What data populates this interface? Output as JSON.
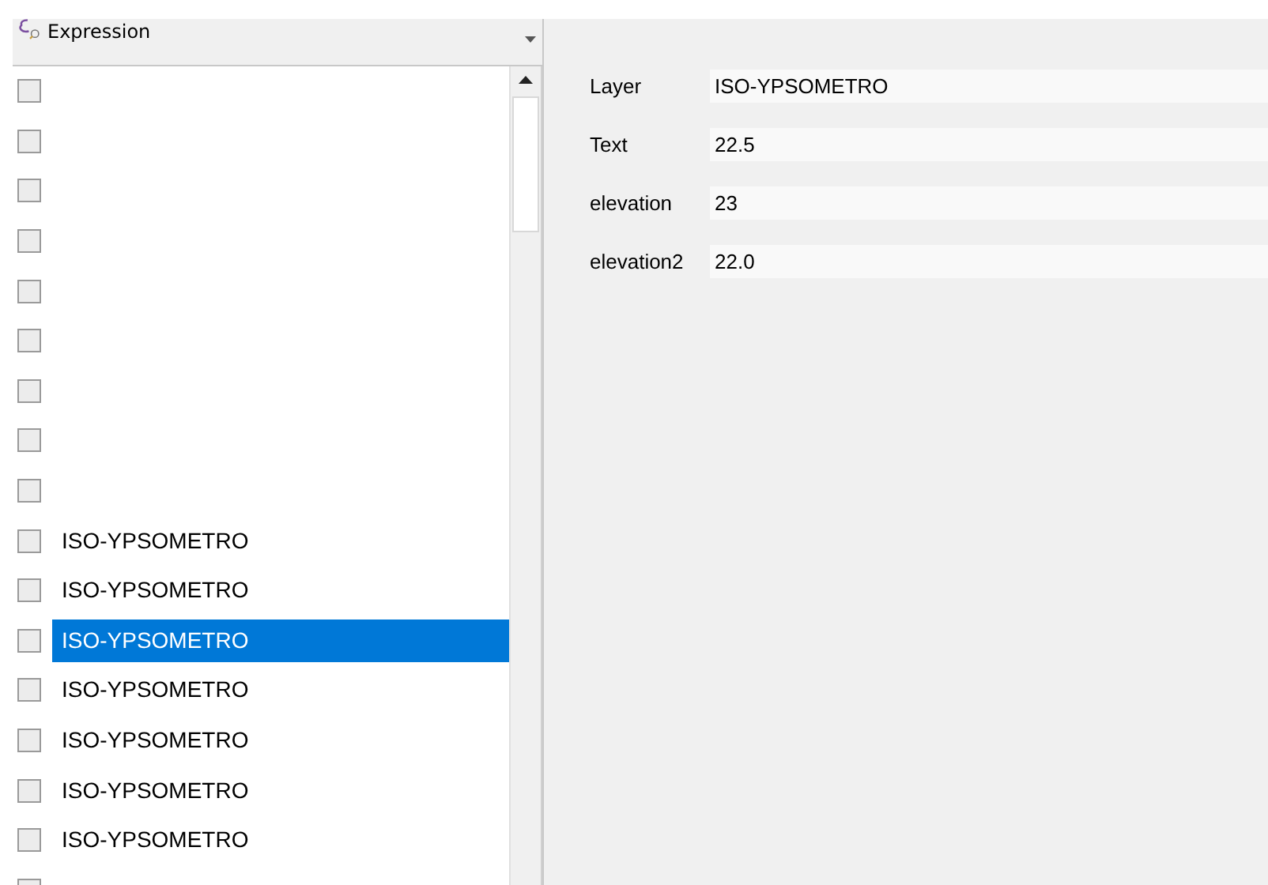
{
  "expression": {
    "label": "Expression"
  },
  "list": {
    "rows": [
      {
        "checked": false,
        "selected": false
      },
      {
        "checked": false,
        "selected": false
      },
      {
        "checked": false,
        "selected": false
      },
      {
        "checked": false,
        "selected": false
      },
      {
        "checked": false,
        "selected": false
      },
      {
        "checked": false,
        "selected": false
      },
      {
        "checked": false,
        "selected": false
      },
      {
        "checked": false,
        "selected": false
      },
      {
        "checked": false,
        "selected": false
      },
      {
        "label": "ISO-YPSOMETRO",
        "checked": false,
        "selected": false
      },
      {
        "label": "ISO-YPSOMETRO",
        "checked": false,
        "selected": false
      },
      {
        "label": "ISO-YPSOMETRO",
        "checked": false,
        "selected": true
      },
      {
        "label": "ISO-YPSOMETRO",
        "checked": false,
        "selected": false
      },
      {
        "label": "ISO-YPSOMETRO",
        "checked": false,
        "selected": false
      },
      {
        "label": "ISO-YPSOMETRO",
        "checked": false,
        "selected": false
      },
      {
        "label": "ISO-YPSOMETRO",
        "checked": false,
        "selected": false
      },
      {
        "checked": false,
        "selected": false
      }
    ]
  },
  "attributes": [
    {
      "label": "Layer",
      "value": "ISO-YPSOMETRO"
    },
    {
      "label": "Text",
      "value": "22.5"
    },
    {
      "label": "elevation",
      "value": "23"
    },
    {
      "label": "elevation2",
      "value": "22.0"
    }
  ]
}
